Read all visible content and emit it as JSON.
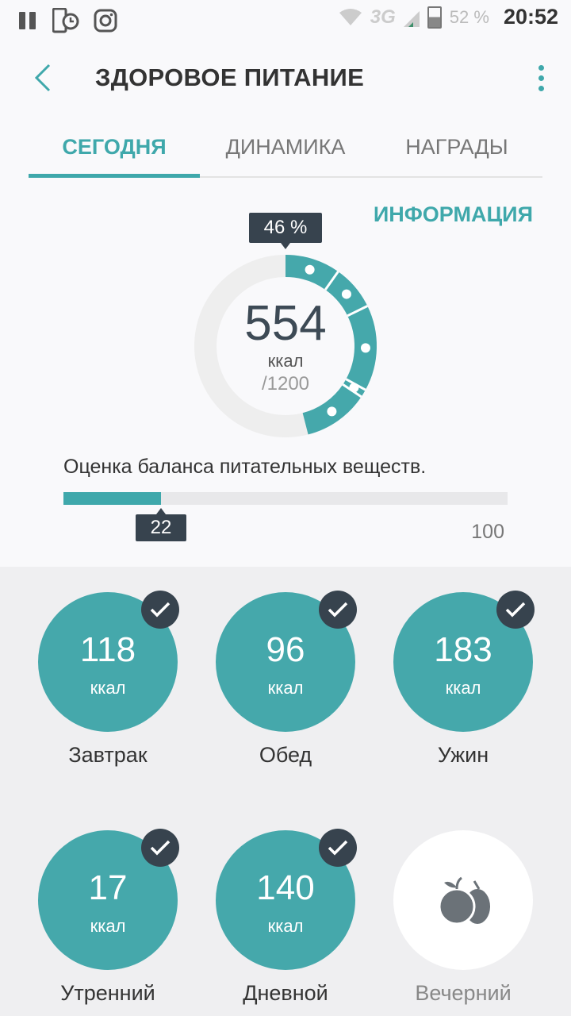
{
  "status_bar": {
    "network": "3G",
    "battery": "52 %",
    "time": "20:52"
  },
  "app_bar": {
    "title": "ЗДОРОВОЕ ПИТАНИЕ"
  },
  "tabs": [
    {
      "label": "СЕГОДНЯ",
      "active": true
    },
    {
      "label": "ДИНАМИКА",
      "active": false
    },
    {
      "label": "НАГРАДЫ",
      "active": false
    }
  ],
  "info_link": "ИНФОРМАЦИЯ",
  "summary": {
    "percent_label": "46 %",
    "percent": 46,
    "calories": "554",
    "unit": "ккал",
    "goal": "/1200"
  },
  "balance": {
    "label": "Оценка баланса питательных веществ.",
    "score": "22",
    "max": "100",
    "fraction": 0.22
  },
  "meals": [
    {
      "name": "Завтрак",
      "kcal": "118",
      "unit": "ккал",
      "done": true
    },
    {
      "name": "Обед",
      "kcal": "96",
      "unit": "ккал",
      "done": true
    },
    {
      "name": "Ужин",
      "kcal": "183",
      "unit": "ккал",
      "done": true
    },
    {
      "name": "Утренний",
      "kcal": "17",
      "unit": "ккал",
      "done": true
    },
    {
      "name": "Дневной",
      "kcal": "140",
      "unit": "ккал",
      "done": true
    },
    {
      "name": "Вечерний",
      "kcal": "",
      "unit": "",
      "done": false,
      "icon": "fruit-icon"
    }
  ],
  "colors": {
    "accent": "#45a8ab",
    "dark": "#37434e",
    "track": "#eeeeee"
  }
}
